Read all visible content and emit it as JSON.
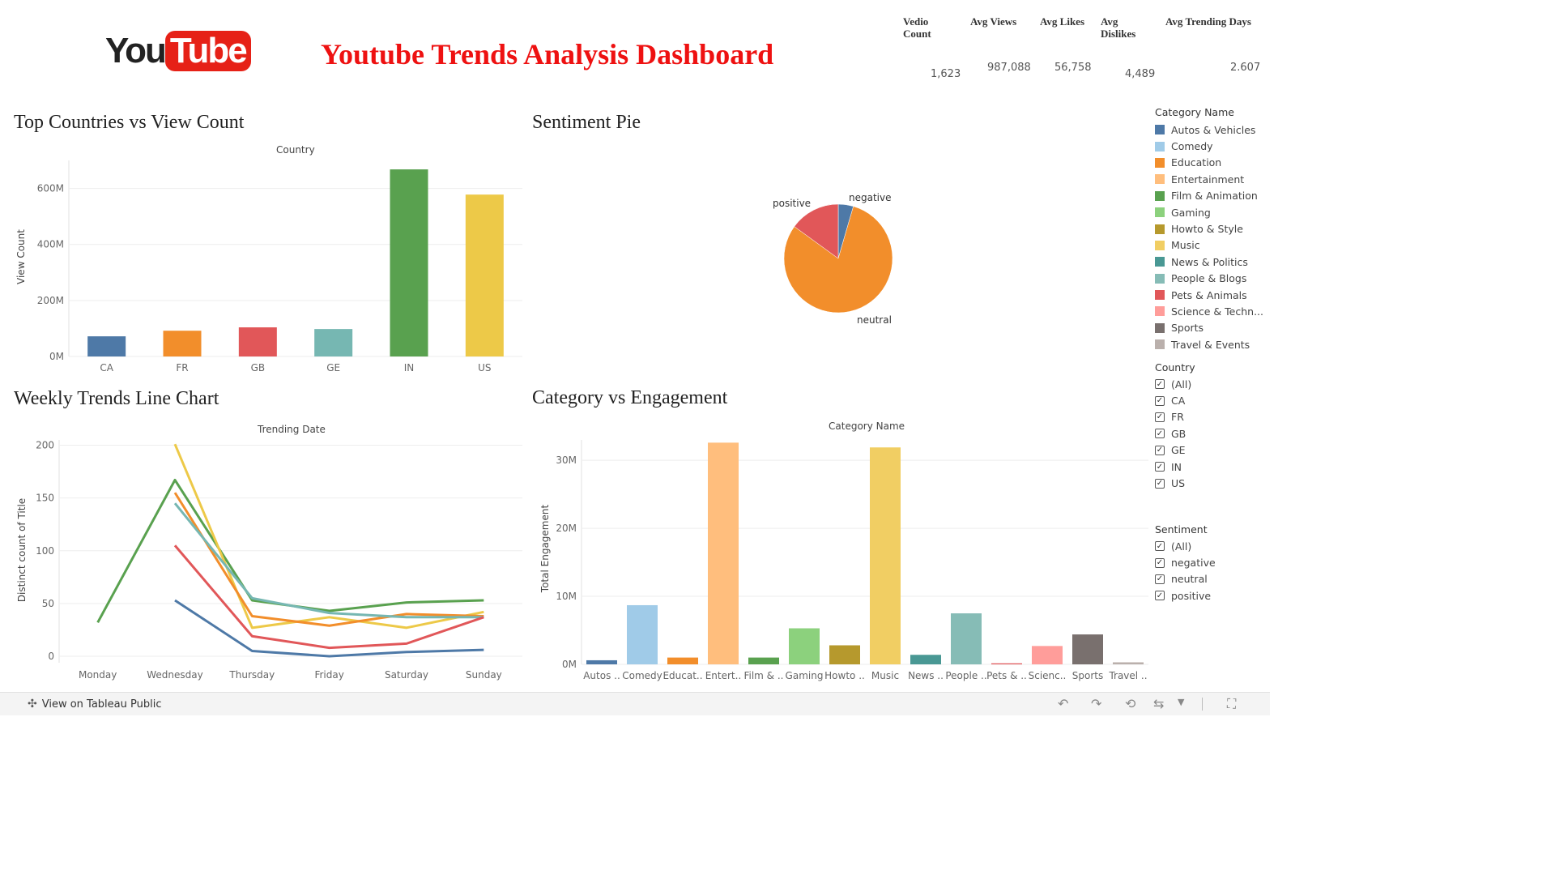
{
  "logo": {
    "you": "You",
    "tube": "Tube"
  },
  "title": "Youtube Trends Analysis Dashboard",
  "kpis": [
    {
      "label_lines": [
        "Vedio",
        "Count"
      ],
      "value": "1,623"
    },
    {
      "label_lines": [
        "Avg Views"
      ],
      "value": "987,088"
    },
    {
      "label_lines": [
        "Avg Likes"
      ],
      "value": "56,758"
    },
    {
      "label_lines": [
        "Avg",
        "Dislikes"
      ],
      "value": "4,489"
    },
    {
      "label_lines": [
        "Avg Trending Days"
      ],
      "value": "2.607"
    }
  ],
  "sections": {
    "countries": "Top Countries vs View Count",
    "sentiment": "Sentiment Pie",
    "weekly": "Weekly Trends Line Chart",
    "category": "Category vs Engagement"
  },
  "colors": {
    "Autos & Vehicles": "#4e79a7",
    "Comedy": "#a0cbe8",
    "Education": "#f28e2b",
    "Entertainment": "#ffbe7d",
    "Film & Animation": "#59a14f",
    "Gaming": "#8cd17d",
    "Howto & Style": "#b6992d",
    "Music": "#f1ce63",
    "News & Politics": "#499894",
    "People & Blogs": "#86bcb6",
    "Pets & Animals": "#e15759",
    "Science & Technology": "#ff9d9a",
    "Sports": "#79706e",
    "Travel & Events": "#bab0ac"
  },
  "legend": {
    "title": "Category Name",
    "items": [
      "Autos & Vehicles",
      "Comedy",
      "Education",
      "Entertainment",
      "Film & Animation",
      "Gaming",
      "Howto & Style",
      "Music",
      "News & Politics",
      "People & Blogs",
      "Pets & Animals",
      "Science & Techn...",
      "Sports",
      "Travel & Events"
    ],
    "color_keys": [
      "Autos & Vehicles",
      "Comedy",
      "Education",
      "Entertainment",
      "Film & Animation",
      "Gaming",
      "Howto & Style",
      "Music",
      "News & Politics",
      "People & Blogs",
      "Pets & Animals",
      "Science & Technology",
      "Sports",
      "Travel & Events"
    ]
  },
  "filters": {
    "country": {
      "title": "Country",
      "options": [
        "(All)",
        "CA",
        "FR",
        "GB",
        "GE",
        "IN",
        "US"
      ]
    },
    "sentiment": {
      "title": "Sentiment",
      "options": [
        "(All)",
        "negative",
        "neutral",
        "positive"
      ]
    }
  },
  "footer": {
    "link": "View on Tableau Public"
  },
  "chart_data": [
    {
      "id": "countries",
      "type": "bar",
      "title": "Top Countries vs View Count",
      "xlabel": "Country",
      "ylabel": "View Count",
      "categories": [
        "CA",
        "FR",
        "GB",
        "GE",
        "IN",
        "US"
      ],
      "values": [
        72,
        92,
        104,
        98,
        668,
        578
      ],
      "unit": "M",
      "colors": [
        "#4e79a7",
        "#f28e2b",
        "#e15759",
        "#76b7b2",
        "#59a14f",
        "#edc948"
      ],
      "yticks": [
        0,
        200,
        400,
        600
      ],
      "ytick_labels": [
        "0M",
        "200M",
        "400M",
        "600M"
      ],
      "ylim": [
        0,
        700
      ]
    },
    {
      "id": "sentiment",
      "type": "pie",
      "title": "Sentiment Pie",
      "slices": [
        {
          "label": "negative",
          "value": 4.5,
          "color": "#4e79a7"
        },
        {
          "label": "neutral",
          "value": 80.5,
          "color": "#f28e2b"
        },
        {
          "label": "positive",
          "value": 15.0,
          "color": "#e15759"
        }
      ]
    },
    {
      "id": "weekly",
      "type": "line",
      "title": "Weekly Trends Line Chart",
      "xlabel": "Trending Date",
      "ylabel": "Distinct count of Title",
      "categories": [
        "Monday",
        "Wednesday",
        "Thursday",
        "Friday",
        "Saturday",
        "Sunday"
      ],
      "yticks": [
        0,
        50,
        100,
        150,
        200
      ],
      "ylim": [
        0,
        205
      ],
      "series": [
        {
          "color": "#59a14f",
          "values": [
            32,
            167,
            53,
            43,
            51,
            53
          ]
        },
        {
          "color": "#edc948",
          "values": [
            null,
            201,
            27,
            37,
            27,
            42
          ]
        },
        {
          "color": "#f28e2b",
          "values": [
            null,
            155,
            38,
            29,
            40,
            38
          ]
        },
        {
          "color": "#76b7b2",
          "values": [
            null,
            145,
            55,
            41,
            37,
            37
          ]
        },
        {
          "color": "#e15759",
          "values": [
            null,
            105,
            19,
            8,
            12,
            37
          ]
        },
        {
          "color": "#4e79a7",
          "values": [
            null,
            53,
            5,
            0,
            4,
            6
          ]
        }
      ]
    },
    {
      "id": "category",
      "type": "bar",
      "title": "Category vs Engagement",
      "xlabel": "Category Name",
      "ylabel": "Total Engagement",
      "categories": [
        "Autos ..",
        "Comedy",
        "Educat..",
        "Entert..",
        "Film & ..",
        "Gaming",
        "Howto ..",
        "Music",
        "News ..",
        "People ..",
        "Pets & ..",
        "Scienc..",
        "Sports",
        "Travel .."
      ],
      "color_keys": [
        "Autos & Vehicles",
        "Comedy",
        "Education",
        "Entertainment",
        "Film & Animation",
        "Gaming",
        "Howto & Style",
        "Music",
        "News & Politics",
        "People & Blogs",
        "Pets & Animals",
        "Science & Technology",
        "Sports",
        "Travel & Events"
      ],
      "values": [
        0.6,
        8.7,
        1.0,
        32.6,
        1.0,
        5.3,
        2.8,
        31.9,
        1.4,
        7.5,
        0.15,
        2.7,
        4.4,
        0.3
      ],
      "unit": "M",
      "yticks": [
        0,
        10,
        20,
        30
      ],
      "ytick_labels": [
        "0M",
        "10M",
        "20M",
        "30M"
      ],
      "ylim": [
        0,
        33
      ]
    }
  ]
}
